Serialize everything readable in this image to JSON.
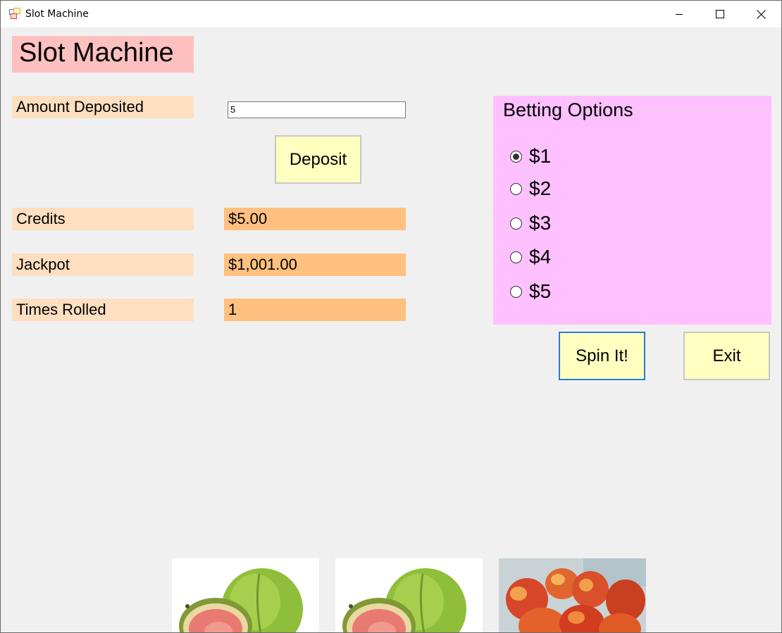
{
  "window": {
    "title": "Slot Machine",
    "controls": {
      "minimize": "minimize-icon",
      "maximize": "maximize-icon",
      "close": "close-icon"
    }
  },
  "form": {
    "heading": "Slot Machine",
    "amount_deposited_label": "Amount Deposited",
    "amount_deposited_value": "5",
    "deposit_button": "Deposit",
    "credits_label": "Credits",
    "credits_value": "$5.00",
    "jackpot_label": "Jackpot",
    "jackpot_value": "$1,001.00",
    "times_rolled_label": "Times Rolled",
    "times_rolled_value": "1"
  },
  "betting": {
    "title": "Betting Options",
    "options": [
      {
        "label": "$1",
        "checked": true
      },
      {
        "label": "$2",
        "checked": false
      },
      {
        "label": "$3",
        "checked": false
      },
      {
        "label": "$4",
        "checked": false
      },
      {
        "label": "$5",
        "checked": false
      }
    ]
  },
  "actions": {
    "spin": "Spin It!",
    "exit": "Exit"
  },
  "reels": [
    {
      "fruit": "guava"
    },
    {
      "fruit": "guava"
    },
    {
      "fruit": "peach"
    }
  ],
  "colors": {
    "heading_bg": "#ffc0c0",
    "label_bg": "#ffdfc0",
    "value_bg": "#ffc080",
    "button_bg": "#ffffc0",
    "group_bg": "#ffc0ff",
    "focus_border": "#2c7bd6"
  }
}
